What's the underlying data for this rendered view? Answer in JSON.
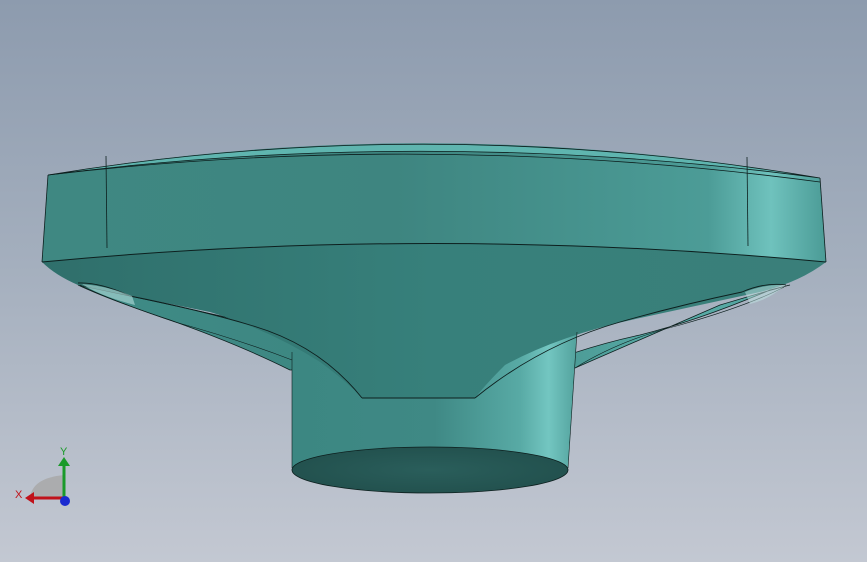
{
  "viewport": {
    "background_top": "#8d9bae",
    "background_bottom": "#c3c8d2"
  },
  "model": {
    "part_color": "#3f8c87",
    "edge_color": "#0d1f1e"
  },
  "triad": {
    "x_label": "X",
    "y_label": "Y",
    "x_color": "#c0121a",
    "y_color": "#1a9a2a",
    "z_color": "#1a2ad0"
  }
}
